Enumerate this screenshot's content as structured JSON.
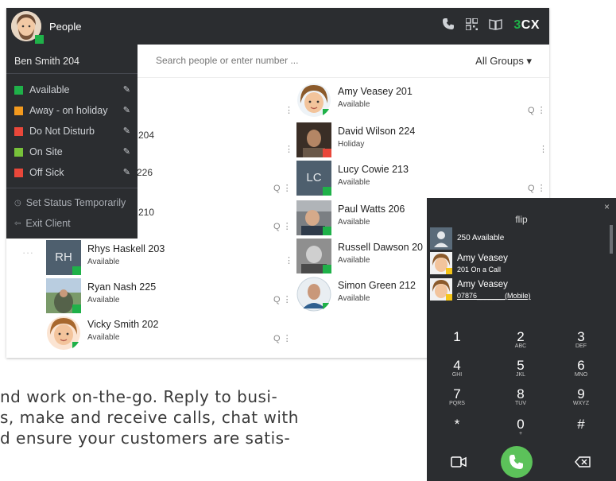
{
  "header": {
    "title": "People",
    "brand_prefix": "3",
    "brand_suffix": "CX",
    "icons": [
      "phone-icon",
      "qr-code-icon",
      "address-book-icon"
    ]
  },
  "search": {
    "placeholder": "Search people or enter number ...",
    "groups_label": "All Groups ▾"
  },
  "status_menu": {
    "user": "Ben Smith 204",
    "items": [
      {
        "label": "Available",
        "color": "#1fb149"
      },
      {
        "label": "Away - on holiday",
        "color": "#f39a1e"
      },
      {
        "label": "Do Not Disturb",
        "color": "#e9473a"
      },
      {
        "label": "On Site",
        "color": "#77c23a"
      },
      {
        "label": "Off Sick",
        "color": "#e9473a"
      }
    ],
    "set_status": "Set Status Temporarily",
    "exit": "Exit Client"
  },
  "left_fragments": {
    "f1": "204",
    "f2": "226",
    "f3": "210"
  },
  "left_contacts": [
    {
      "initials": "RH",
      "name": "Rhys Haskell 203",
      "status": "Available"
    },
    {
      "name": "Ryan Nash 225",
      "status": "Available"
    },
    {
      "name": "Vicky Smith 202",
      "status": "Available"
    }
  ],
  "right_contacts": [
    {
      "name": "Amy Veasey 201",
      "status": "Available"
    },
    {
      "name": "David Wilson 224",
      "status": "Holiday"
    },
    {
      "initials": "LC",
      "name": "Lucy Cowie 213",
      "status": "Available"
    },
    {
      "name": "Paul Watts 206",
      "status": "Available"
    },
    {
      "name": "Russell Dawson 20",
      "status": "Available"
    },
    {
      "name": "Simon Green 212",
      "status": "Available"
    }
  ],
  "row_icons": {
    "search_glyph": "Q",
    "more_glyph": "⋮",
    "ellipsis": "···"
  },
  "colors": {
    "available": "#1fb149",
    "holiday": "#e9473a",
    "dark_bg": "#2b2d30",
    "call_green": "#5cc25a"
  },
  "dialer": {
    "entry": "flip",
    "close": "×",
    "suggestions": [
      {
        "l1": "250 Available",
        "l2": ""
      },
      {
        "l1": "Amy Veasey",
        "l2": "201 On a Call"
      },
      {
        "l1": "Amy Veasey",
        "l2": "07876_______(Mobile)"
      }
    ],
    "keys": [
      {
        "d": "1",
        "s": ""
      },
      {
        "d": "2",
        "s": "ABC"
      },
      {
        "d": "3",
        "s": "DEF"
      },
      {
        "d": "4",
        "s": "GHI"
      },
      {
        "d": "5",
        "s": "JKL"
      },
      {
        "d": "6",
        "s": "MNO"
      },
      {
        "d": "7",
        "s": "PQRS"
      },
      {
        "d": "8",
        "s": "TUV"
      },
      {
        "d": "9",
        "s": "WXYZ"
      },
      {
        "d": "*",
        "s": ""
      },
      {
        "d": "0",
        "s": "+"
      },
      {
        "d": "#",
        "s": ""
      }
    ]
  },
  "body_text": {
    "line1": "nd work on-the-go. Reply to busi-",
    "line2": "s, make and receive calls, chat with",
    "line3": "d ensure your customers are satis-"
  }
}
